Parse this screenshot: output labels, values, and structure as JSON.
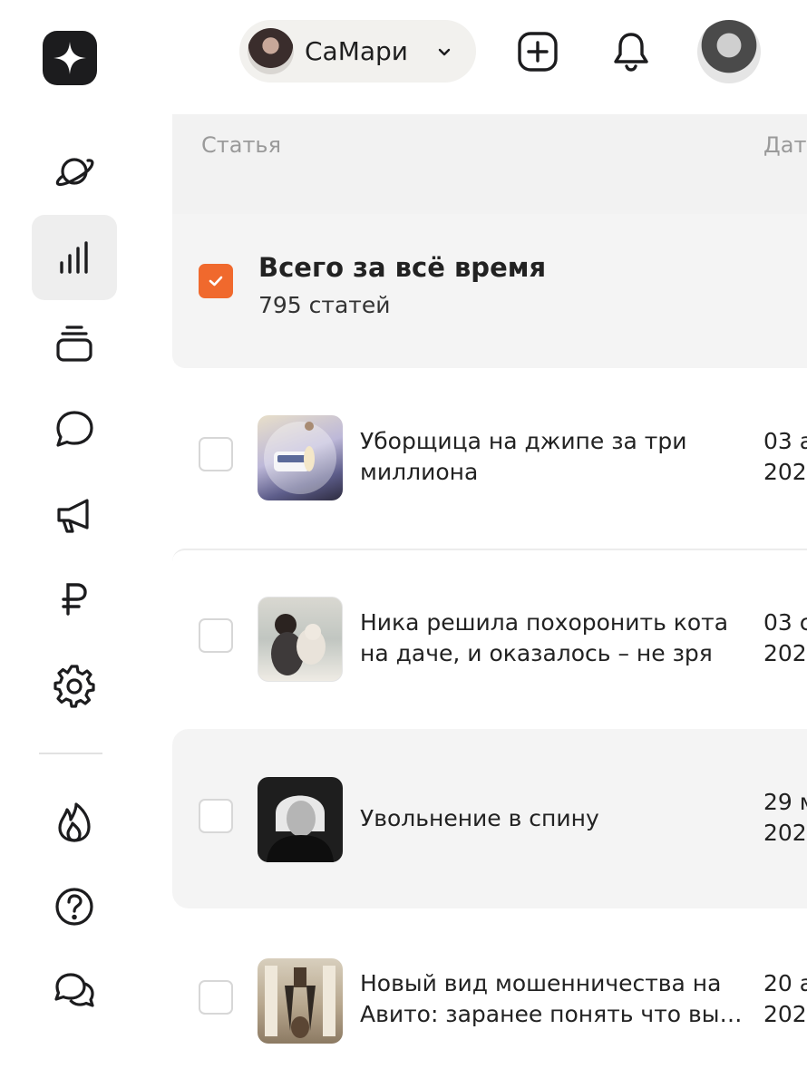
{
  "channel": {
    "name": "СаМари"
  },
  "sidebar": {
    "items": [
      {
        "icon": "planet-icon",
        "active": false
      },
      {
        "icon": "stats-icon",
        "active": true
      },
      {
        "icon": "stack-icon",
        "active": false
      },
      {
        "icon": "comment-icon",
        "active": false
      },
      {
        "icon": "megaphone-icon",
        "active": false
      },
      {
        "icon": "ruble-icon",
        "active": false
      },
      {
        "icon": "gear-icon",
        "active": false
      },
      {
        "icon": "fire-icon",
        "active": false
      },
      {
        "icon": "help-icon",
        "active": false
      },
      {
        "icon": "chat-icon",
        "active": false
      }
    ]
  },
  "table": {
    "col_article": "Статья",
    "col_date": "Дат",
    "total": {
      "title": "Всего за всё время",
      "count": "795 статей",
      "checked": true
    },
    "rows": [
      {
        "title": "Уборщица на джипе за три миллиона",
        "date_line1": "03 а",
        "date_line2": "202"
      },
      {
        "title": "Ника решила похоронить кота на даче, и оказалось – не зря",
        "date_line1": "03 с",
        "date_line2": "202"
      },
      {
        "title": "Увольнение в спину",
        "date_line1": "29 м",
        "date_line2": "202"
      },
      {
        "title": "Новый вид мошенничества на Авито: заранее понять что вы…",
        "date_line1": "20 а",
        "date_line2": "202"
      }
    ]
  },
  "colors": {
    "accent": "#f0692d",
    "active_bg": "#eeeeee",
    "header_bg": "#f2f2f2"
  }
}
